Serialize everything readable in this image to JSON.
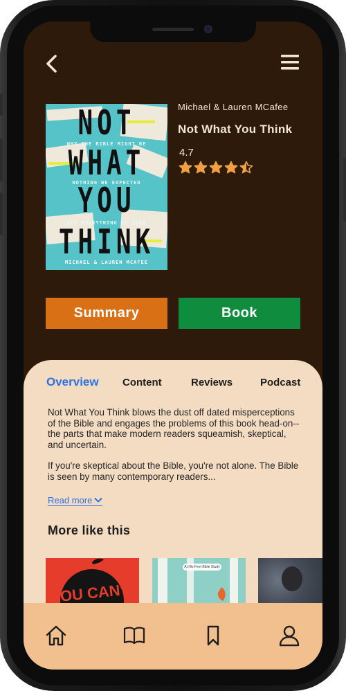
{
  "header": {
    "back_icon": "chevron-left-icon",
    "menu_icon": "hamburger-menu-icon"
  },
  "book": {
    "author": "Michael & Lauren MCafee",
    "title": "Not What You Think",
    "rating": "4.7",
    "rating_value": 4.5,
    "rating_max": 5,
    "cover": {
      "words": [
        "NOT",
        "WHAT",
        "YOU",
        "THINK"
      ],
      "taglines": [
        "WHY THE BIBLE MIGHT BE",
        "NOTHING WE EXPECTED",
        "YET EVERYTHING WE NEED"
      ],
      "author_line": "MICHAEL & LAUREN MCAFEE"
    }
  },
  "actions": {
    "summary_label": "Summary",
    "book_label": "Book",
    "summary_color": "#d97016",
    "book_color": "#0f8c3e"
  },
  "tabs": [
    {
      "label": "Overview",
      "active": true
    },
    {
      "label": "Content",
      "active": false
    },
    {
      "label": "Reviews",
      "active": false
    },
    {
      "label": "Podcast",
      "active": false
    }
  ],
  "overview": {
    "paragraph1": "Not What You Think blows the dust off dated misperceptions of the Bible and engages the problems of this book head-on--the parts that make modern readers squeamish, skeptical, and uncertain.",
    "paragraph2": "If you're skeptical about the Bible, you're not alone. The Bible is seen by many contemporary readers...",
    "read_more": "Read more"
  },
  "more_like_this": {
    "title": "More like this",
    "items": [
      {
        "cover_text": "YOU CAN'T"
      },
      {
        "cover_text": "At His Feet Bible Study"
      },
      {
        "cover_text": ""
      }
    ]
  },
  "bottom_nav": [
    {
      "icon": "home-icon"
    },
    {
      "icon": "open-book-icon"
    },
    {
      "icon": "bookmark-icon"
    },
    {
      "icon": "profile-icon"
    }
  ],
  "colors": {
    "background": "#2d1a0b",
    "panel": "#f3dcc2",
    "nav": "#f2c08f",
    "accent_blue": "#2a71e4",
    "star": "#f0a040"
  }
}
